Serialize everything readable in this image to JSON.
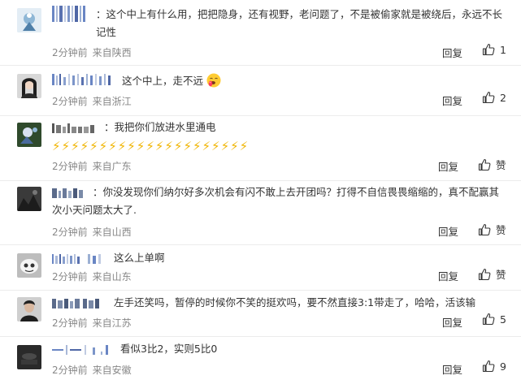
{
  "comments": [
    {
      "text": "这个中上有什么用，把把隐身，还有视野，老问题了，不是被偷家就是被绕后，永远不长记性",
      "time": "2分钟前",
      "location": "来自陕西",
      "reply_label": "回复",
      "likes": "1"
    },
    {
      "text": "这个中上，走不远",
      "time": "2分钟前",
      "location": "来自浙江",
      "reply_label": "回复",
      "likes": "2"
    },
    {
      "text": "我把你们放进水里通电",
      "bolts": "⚡⚡⚡⚡⚡⚡⚡⚡⚡⚡⚡⚡⚡⚡⚡⚡⚡⚡⚡⚡⚡",
      "time": "2分钟前",
      "location": "来自广东",
      "reply_label": "回复",
      "likes": "赞"
    },
    {
      "text": "你没发现你们纳尔好多次机会有闪不敢上去开团吗？打得不自信畏畏缩缩的，真不配赢其次小天问题太大了.",
      "time": "2分钟前",
      "location": "来自山西",
      "reply_label": "回复",
      "likes": "赞"
    },
    {
      "text": "这么上单啊",
      "time": "2分钟前",
      "location": "来自山东",
      "reply_label": "回复",
      "likes": "赞"
    },
    {
      "text": "左手还笑吗，暂停的时候你不笑的挺欢吗，要不然直接3:1带走了，哈哈，活该输",
      "time": "2分钟前",
      "location": "来自江苏",
      "reply_label": "回复",
      "likes": "5"
    },
    {
      "text": "看似3比2，实则5比0",
      "time": "2分钟前",
      "location": "来自安徽",
      "reply_label": "回复",
      "likes": "9"
    }
  ],
  "colon": "：",
  "colors": {
    "text": "#333333",
    "meta": "#888888",
    "divider": "#ececec",
    "bolt": "#f0b400"
  },
  "icons": {
    "like": "thumbs-up-icon",
    "emoji": "drooling-face-emoji"
  }
}
